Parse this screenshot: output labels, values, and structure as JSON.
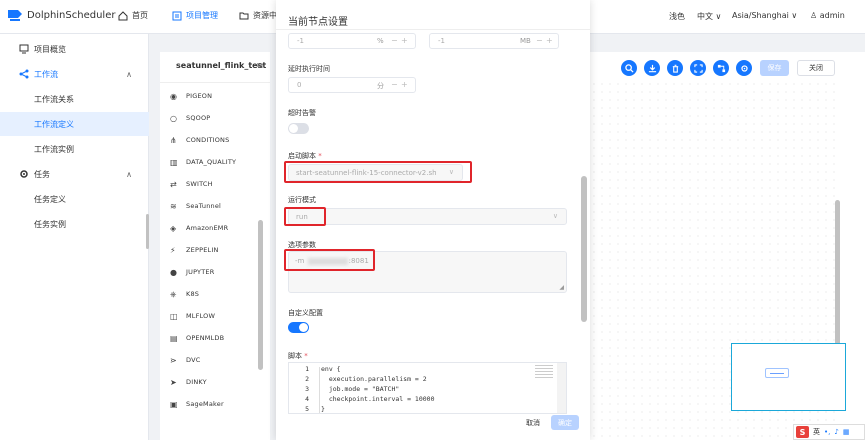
{
  "app": {
    "name": "DolphinScheduler"
  },
  "nav": {
    "home": "首页",
    "project": "项目管理",
    "resource": "资源中"
  },
  "topright": {
    "theme": "浅色",
    "lang": "中文",
    "timezone": "Asia/Shanghai",
    "user": "admin"
  },
  "sidebar": {
    "items": [
      {
        "label": "项目概览"
      },
      {
        "label": "工作流"
      },
      {
        "label": "工作流关系"
      },
      {
        "label": "工作流定义"
      },
      {
        "label": "工作流实例"
      },
      {
        "label": "任务"
      },
      {
        "label": "任务定义"
      },
      {
        "label": "任务实例"
      }
    ]
  },
  "tasks": {
    "title": "seatunnel_flink_test",
    "items": [
      "PIGEON",
      "SQOOP",
      "CONDITIONS",
      "DATA_QUALITY",
      "SWITCH",
      "SeaTunnel",
      "AmazonEMR",
      "ZEPPELIN",
      "JUPYTER",
      "K8S",
      "MLFLOW",
      "OPENMLDB",
      "DVC",
      "DINKY",
      "SageMaker"
    ]
  },
  "toolbar": {
    "save": "保存",
    "close": "关闭"
  },
  "drawer": {
    "title": "当前节点设置",
    "cpu": {
      "value": "-1",
      "unit": "%"
    },
    "memory": {
      "value": "-1",
      "unit": "MB"
    },
    "delay_label": "延时执行时间",
    "delay": {
      "value": "0",
      "unit": "分"
    },
    "timeout_label": "超时告警",
    "startup_label": "启动脚本",
    "startup_value": "start-seatunnel-flink-15-connector-v2.sh",
    "runmode_label": "运行模式",
    "runmode_value": "run",
    "options_label": "选项参数",
    "options_prefix": "-m",
    "options_suffix": ":8081",
    "custom_label": "自定义配置",
    "script_label": "脚本",
    "code": [
      {
        "ln": "1",
        "text": "env {"
      },
      {
        "ln": "2",
        "text": "  execution.parallelism = 2"
      },
      {
        "ln": "3",
        "text": "  job.mode = \"BATCH\""
      },
      {
        "ln": "4",
        "text": "  checkpoint.interval = 10000"
      },
      {
        "ln": "5",
        "text": "}"
      }
    ],
    "cancel": "取消",
    "ok": "确定"
  },
  "ime": {
    "lang": "英"
  },
  "colors": {
    "primary": "#1677ff",
    "highlight": "#e0252b"
  }
}
